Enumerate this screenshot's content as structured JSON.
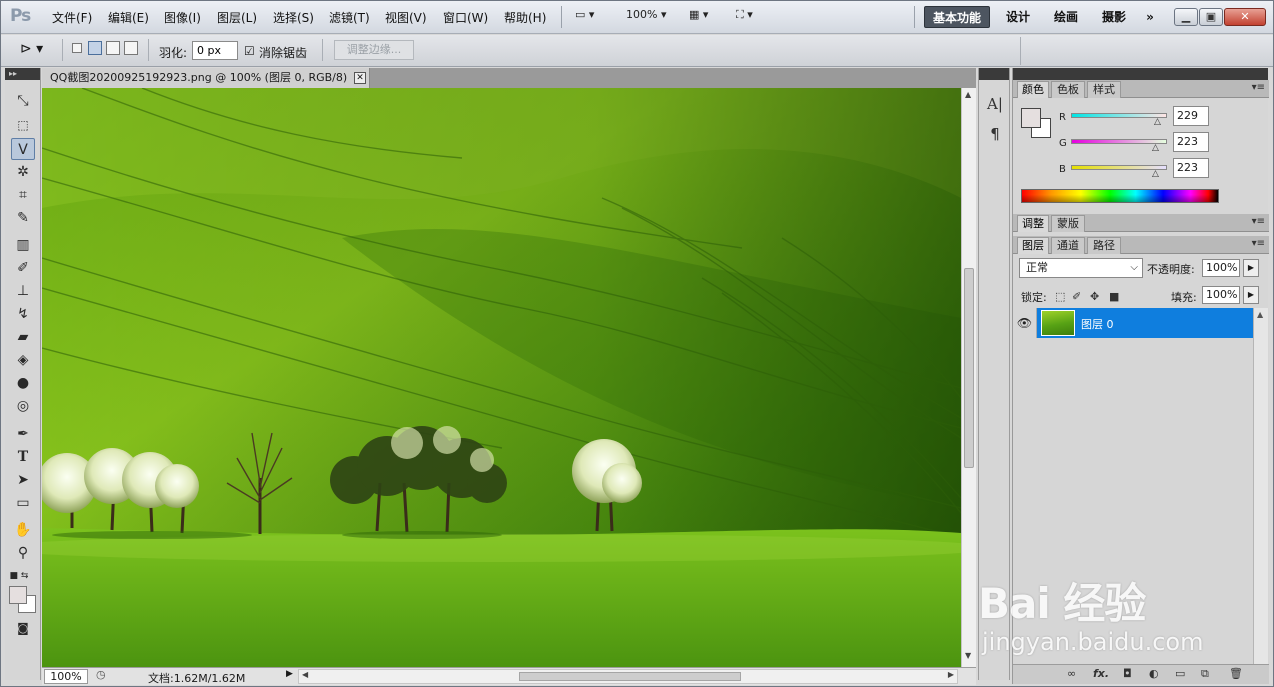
{
  "app": {
    "logo": "Ps"
  },
  "menu": {
    "items": [
      "文件(F)",
      "编辑(E)",
      "图像(I)",
      "图层(L)",
      "选择(S)",
      "滤镜(T)",
      "视图(V)",
      "窗口(W)",
      "帮助(H)"
    ],
    "zoom": "100%",
    "workspaces": [
      "基本功能",
      "设计",
      "绘画",
      "摄影"
    ],
    "more": "»"
  },
  "options": {
    "feather_label": "羽化:",
    "feather_value": "0 px",
    "antialias_label": "消除锯齿",
    "antialias_checked": true,
    "refine_edge": "调整边缘..."
  },
  "tools": [
    "move-tool",
    "marquee-tool",
    "polygonal-lasso-tool",
    "magic-wand-tool",
    "crop-tool",
    "eyedropper-tool",
    "healing-brush-tool",
    "brush-tool",
    "clone-stamp-tool",
    "history-brush-tool",
    "eraser-tool",
    "paint-bucket-tool",
    "blur-tool",
    "dodge-tool",
    "pen-tool",
    "type-tool",
    "path-selection-tool",
    "shape-tool",
    "hand-tool",
    "zoom-tool"
  ],
  "document": {
    "tab_title": "QQ截图20200925192923.png @ 100% (图层 0, RGB/8)",
    "zoom": "100%",
    "doc_info": "文档:1.62M/1.62M"
  },
  "panels": {
    "color_tabs": [
      "颜色",
      "色板",
      "样式"
    ],
    "channels": [
      {
        "label": "R",
        "value": "229",
        "gradient": "#00e5e5,#ffe5e5"
      },
      {
        "label": "G",
        "value": "223",
        "gradient": "#e500df,#e5ffdf"
      },
      {
        "label": "B",
        "value": "223",
        "gradient": "#e5df00,#e5dfff"
      }
    ],
    "foreground_color": "#e5dfdf",
    "background_color": "#ffffff",
    "adjust_tabs": [
      "调整",
      "蒙版"
    ],
    "layer_tabs": [
      "图层",
      "通道",
      "路径"
    ],
    "blend_mode": "正常",
    "opacity_label": "不透明度:",
    "opacity_value": "100%",
    "lock_label": "锁定:",
    "fill_label": "填充:",
    "fill_value": "100%",
    "layer_name": "图层 0",
    "footer_icons": [
      "link-icon",
      "fx-icon",
      "mask-icon",
      "adjustment-icon",
      "group-icon",
      "new-layer-icon",
      "trash-icon"
    ]
  },
  "watermark": {
    "main": "Bai 经验",
    "url": "jingyan.baidu.com"
  }
}
